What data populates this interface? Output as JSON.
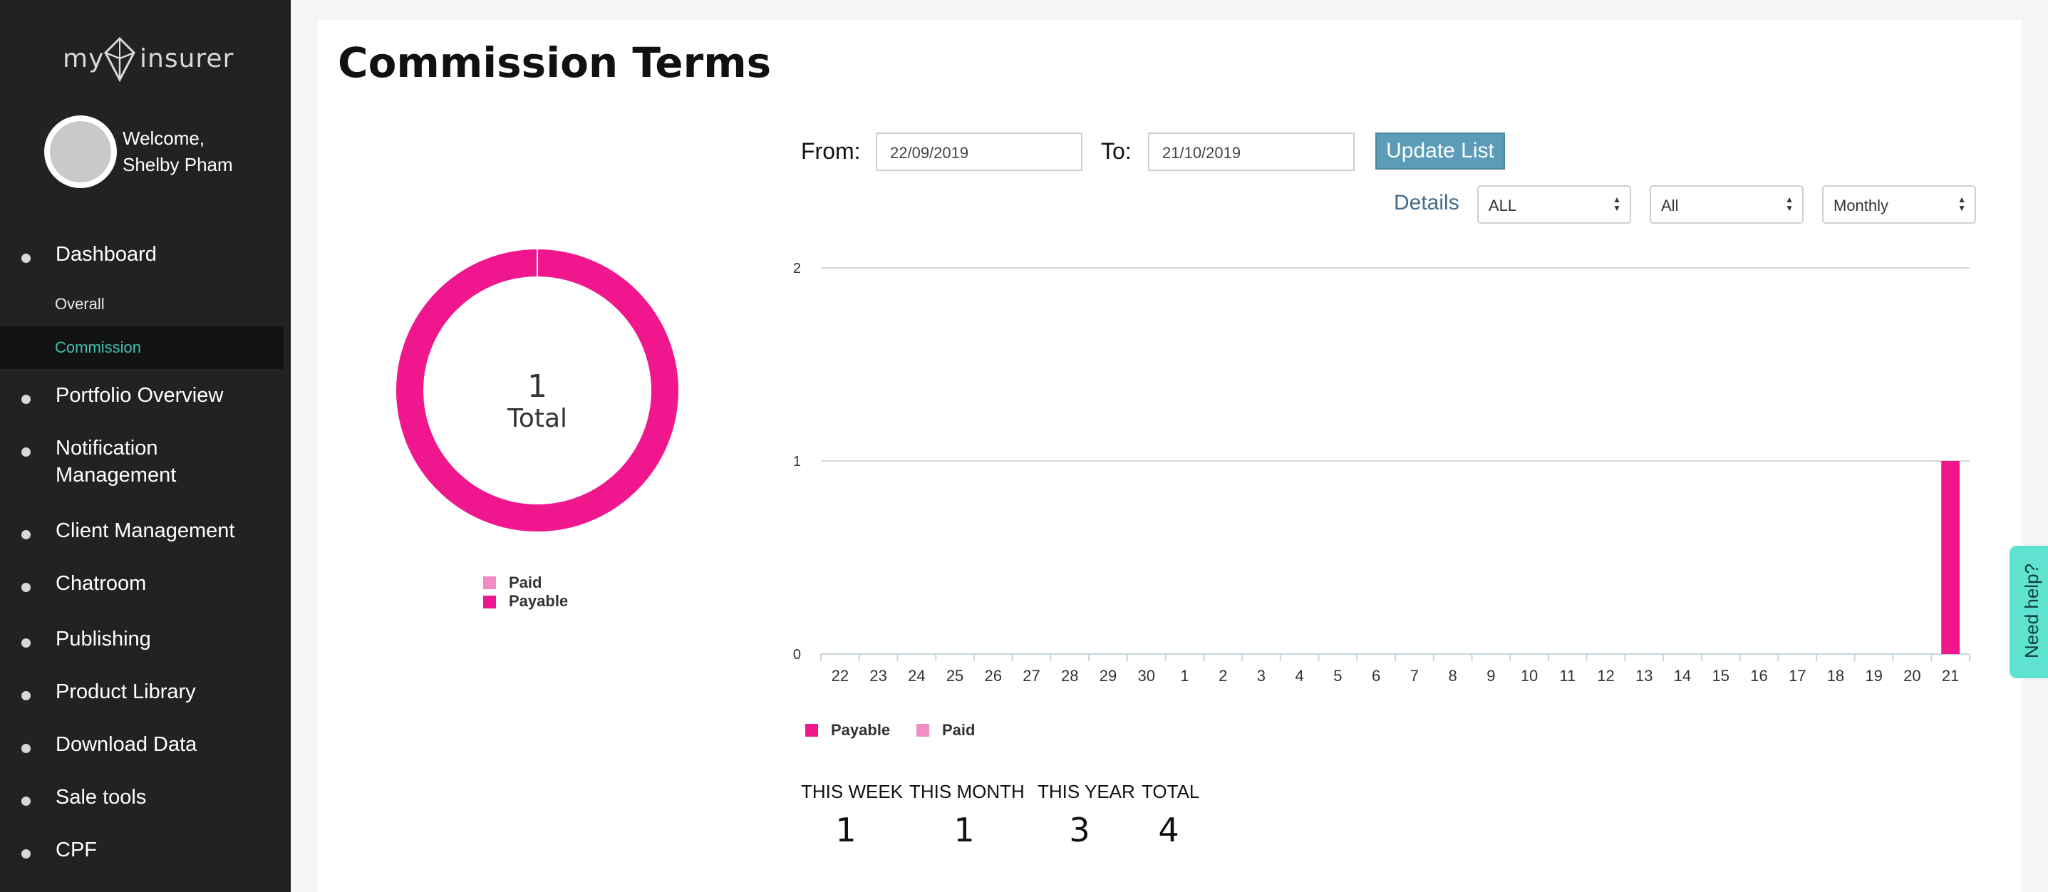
{
  "brand": {
    "word1": "my",
    "word2": "insurer"
  },
  "user": {
    "welcome": "Welcome,",
    "name": "Shelby Pham"
  },
  "nav": {
    "dashboard": "Dashboard",
    "sub": [
      "Overall",
      "Commission"
    ],
    "active_sub": "Commission",
    "items": [
      "Portfolio Overview",
      "Notification\nManagement",
      "Client Management",
      "Chatroom",
      "Publishing",
      "Product Library",
      "Download Data",
      "Sale tools",
      "CPF"
    ]
  },
  "page": {
    "title": "Commission Terms"
  },
  "filters": {
    "from_label": "From:",
    "from_value": "22/09/2019",
    "to_label": "To:",
    "to_value": "21/10/2019",
    "update_label": "Update List",
    "details_label": "Details",
    "select1": "ALL",
    "select2": "All",
    "select3": "Monthly"
  },
  "donut": {
    "count": "1",
    "label": "Total",
    "legend": [
      {
        "name": "Paid",
        "color": "#f28cc4"
      },
      {
        "name": "Payable",
        "color": "#f0178e"
      }
    ]
  },
  "chart_data": {
    "type": "bar",
    "categories": [
      "22",
      "23",
      "24",
      "25",
      "26",
      "27",
      "28",
      "29",
      "30",
      "1",
      "2",
      "3",
      "4",
      "5",
      "6",
      "7",
      "8",
      "9",
      "10",
      "11",
      "12",
      "13",
      "14",
      "15",
      "16",
      "17",
      "18",
      "19",
      "20",
      "21"
    ],
    "series": [
      {
        "name": "Payable",
        "color": "#f0178e",
        "values": [
          0,
          0,
          0,
          0,
          0,
          0,
          0,
          0,
          0,
          0,
          0,
          0,
          0,
          0,
          0,
          0,
          0,
          0,
          0,
          0,
          0,
          0,
          0,
          0,
          0,
          0,
          0,
          0,
          0,
          1
        ]
      },
      {
        "name": "Paid",
        "color": "#f28cc4",
        "values": [
          0,
          0,
          0,
          0,
          0,
          0,
          0,
          0,
          0,
          0,
          0,
          0,
          0,
          0,
          0,
          0,
          0,
          0,
          0,
          0,
          0,
          0,
          0,
          0,
          0,
          0,
          0,
          0,
          0,
          0
        ]
      }
    ],
    "y_ticks": [
      "0",
      "1",
      "2"
    ],
    "ylim": [
      0,
      2
    ],
    "grid": true,
    "legend_position": "bottom-left"
  },
  "stats": [
    {
      "label": "THIS WEEK",
      "value": "1"
    },
    {
      "label": "THIS MONTH",
      "value": "1"
    },
    {
      "label": "THIS YEAR",
      "value": "3"
    },
    {
      "label": "TOTAL",
      "value": "4"
    }
  ],
  "help": {
    "label": "Need help?"
  },
  "colors": {
    "sidebar": "#222222",
    "accent": "#3cc1b0",
    "payable": "#f0178e",
    "paid": "#f28cc4",
    "button": "#5c9cb6",
    "help": "#5fe3cf"
  }
}
